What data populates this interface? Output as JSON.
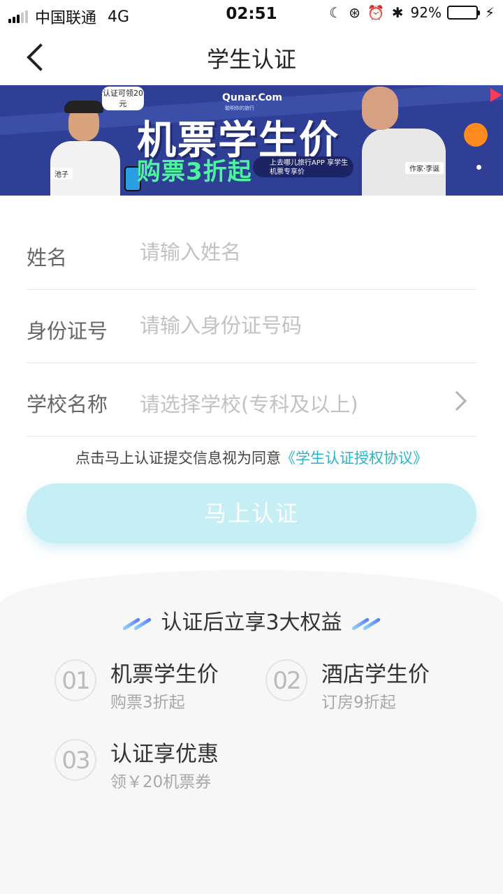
{
  "status_bar": {
    "carrier": "中国联通",
    "network": "4G",
    "time": "02:51",
    "battery_percent": "92%",
    "battery_level": 0.92
  },
  "nav": {
    "title": "学生认证"
  },
  "banner": {
    "bubble_text": "认证可领20元",
    "brand": "Qunar.Com",
    "brand_sub": "聪明你的旅行",
    "headline": "机票学生价",
    "subheadline": "购票3折起",
    "pill_text": "上去哪儿旅行APP 享学生机票专享价",
    "tag_left": "池子",
    "tag_right": "作家·李诞"
  },
  "form": {
    "name": {
      "label": "姓名",
      "placeholder": "请输入姓名"
    },
    "id_number": {
      "label": "身份证号",
      "placeholder": "请输入身份证号码"
    },
    "school": {
      "label": "学校名称",
      "placeholder": "请选择学校(专科及以上)"
    }
  },
  "agreement": {
    "prefix": "点击马上认证提交信息视为同意",
    "link": "《学生认证授权协议》"
  },
  "submit": {
    "label": "马上认证"
  },
  "benefits": {
    "heading": "认证后立享3大权益",
    "items": [
      {
        "num": "01",
        "title": "机票学生价",
        "sub": "购票3折起"
      },
      {
        "num": "02",
        "title": "酒店学生价",
        "sub": "订房9折起"
      },
      {
        "num": "03",
        "title": "认证享优惠",
        "sub": "领￥20机票券"
      }
    ]
  },
  "colors": {
    "accent": "#2ab4c9",
    "button_bg": "#c6eff5",
    "banner_bg": "#2e3f95",
    "banner_green": "#4ff3a0"
  }
}
